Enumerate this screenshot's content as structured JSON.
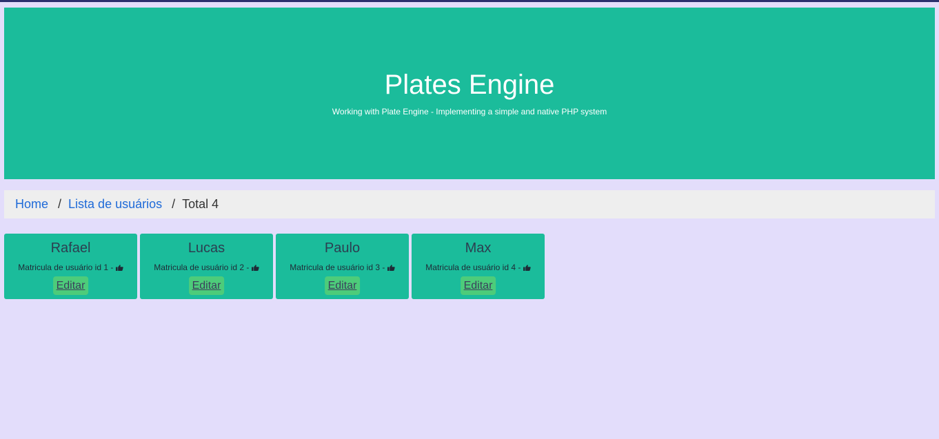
{
  "hero": {
    "title": "Plates Engine",
    "subtitle": "Working with Plate Engine - Implementing a simple and native PHP system"
  },
  "breadcrumb": {
    "home": "Home",
    "separator": "/",
    "list": "Lista de usuários",
    "current": "Total 4"
  },
  "users": [
    {
      "name": "Rafael",
      "info": "Matricula de usuário id 1 -",
      "edit_label": "Editar"
    },
    {
      "name": "Lucas",
      "info": "Matricula de usuário id 2 -",
      "edit_label": "Editar"
    },
    {
      "name": "Paulo",
      "info": "Matricula de usuário id 3 -",
      "edit_label": "Editar"
    },
    {
      "name": "Max",
      "info": "Matricula de usuário id 4 -",
      "edit_label": "Editar"
    }
  ],
  "icons": {
    "card_info_icon": "thumbs-up-icon"
  },
  "colors": {
    "background": "#e3ddfb",
    "hero": "#1bbc9b",
    "card": "#1bbc9b",
    "button": "#4dcc7a",
    "link": "#1e6ad8",
    "breadcrumb_bg": "#eeeeee"
  }
}
